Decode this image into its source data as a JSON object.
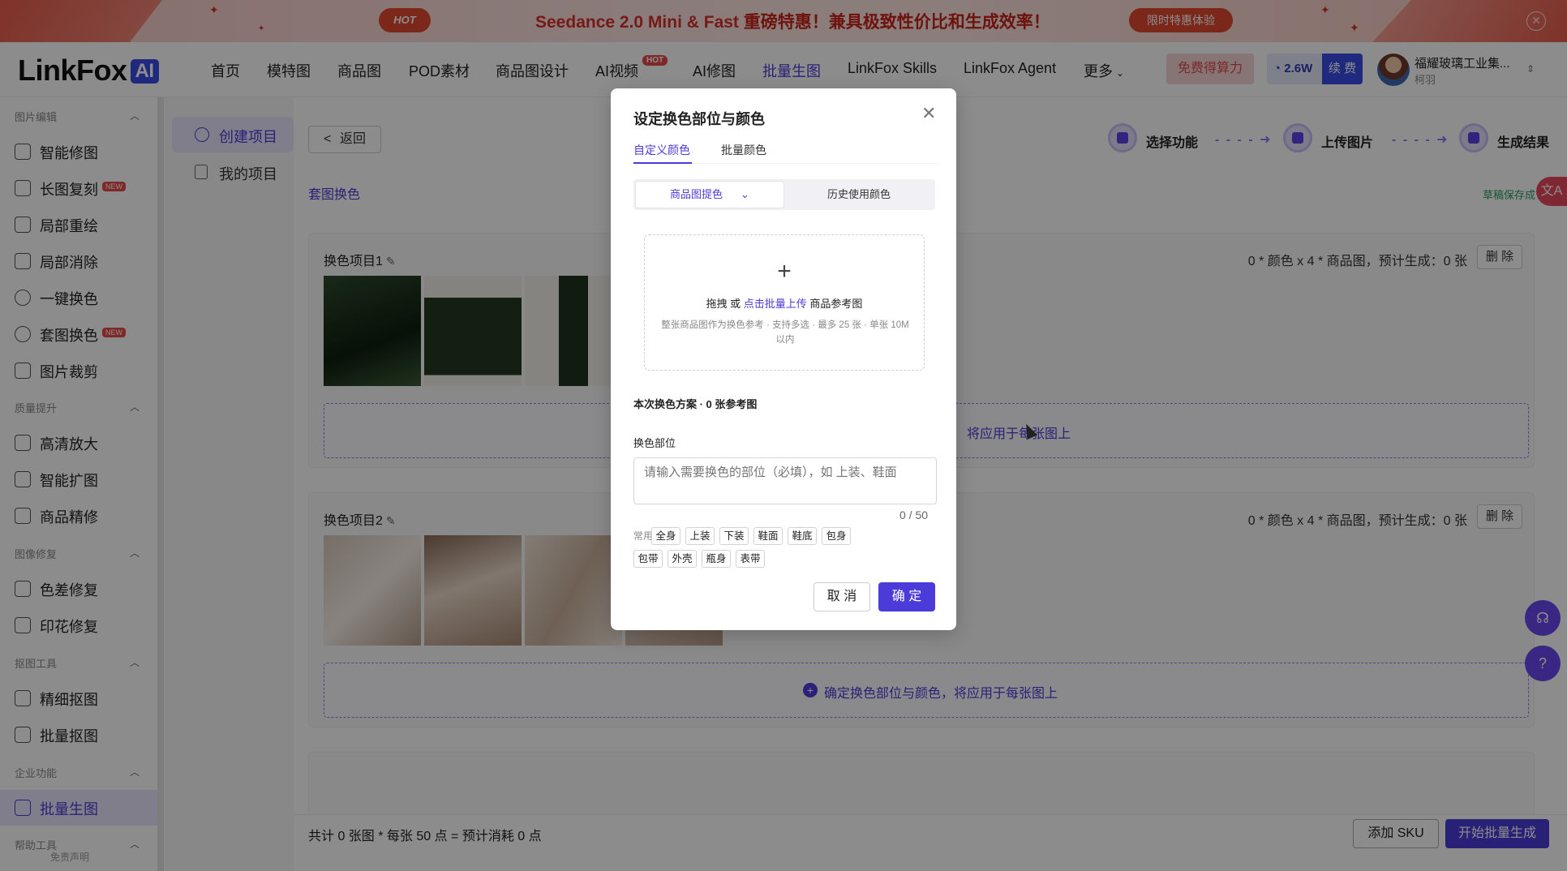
{
  "banner": {
    "hot": "HOT",
    "headline_a": "Seedance 2.0 Mini & Fast",
    "headline_b": " 重磅特惠！兼具极致性价比和生成效率！",
    "cta": "限时特惠体验"
  },
  "navbar": {
    "logo_text": "LinkFox",
    "logo_badge": "AI",
    "items": [
      "首页",
      "模特图",
      "商品图",
      "POD素材",
      "商品图设计",
      "AI视频",
      "AI修图",
      "批量生图",
      "LinkFox Skills",
      "LinkFox Agent",
      "更多"
    ],
    "hot_badge": "HOT",
    "active": "批量生图",
    "free_button": "免费得算力",
    "credit_value": "2.6W",
    "renew_button": "续 费",
    "user_name": "福耀玻璃工业集...",
    "user_sub": "柯羽"
  },
  "sidebar": {
    "groups": [
      {
        "title": "图片编辑",
        "items": [
          "智能修图",
          "长图复刻",
          "局部重绘",
          "局部消除",
          "一键换色",
          "套图换色",
          "图片裁剪"
        ]
      },
      {
        "title": "质量提升",
        "items": [
          "高清放大",
          "智能扩图",
          "商品精修"
        ]
      },
      {
        "title": "图像修复",
        "items": [
          "色差修复",
          "印花修复"
        ]
      },
      {
        "title": "抠图工具",
        "items": [
          "精细抠图",
          "批量抠图"
        ]
      },
      {
        "title": "企业功能",
        "items": [
          "批量生图"
        ]
      },
      {
        "title": "帮助工具",
        "items": []
      }
    ],
    "new_badge": "NEW",
    "footer": "免责声明"
  },
  "subnav": {
    "items": [
      "创建项目",
      "我的项目"
    ]
  },
  "main": {
    "back": "返回",
    "breadcrumb": "套图换色",
    "steps": [
      "选择功能",
      "上传图片",
      "生成结果"
    ],
    "step_arrow": "- - - - ➜",
    "draft": "草稿保存成",
    "translate_icon": "文A",
    "projects": [
      {
        "title": "换色项目1",
        "meta": "0 * 颜色 x 4 * 商品图，预计生成：0 张",
        "delete": "删 除",
        "apply": "确定换色部位与颜色，将应用于每张图上"
      },
      {
        "title": "换色项目2",
        "meta": "0 * 颜色 x 4 * 商品图，预计生成：0 张",
        "delete": "删 除",
        "apply": "确定换色部位与颜色，将应用于每张图上"
      }
    ],
    "apply_partial": "将应用于每张图上",
    "summary": "共计 0 张图 * 每张 50 点 = 预计消耗 0 点",
    "add_sku": "添加 SKU",
    "start": "开始批量生成"
  },
  "modal": {
    "title": "设定换色部位与颜色",
    "tabs": [
      "自定义颜色",
      "批量颜色"
    ],
    "seg_option1": "商品图提色",
    "seg_option2": "历史使用颜色",
    "upload_plus": "+",
    "upload_line1_a": "拖拽 或 ",
    "upload_line1_link": "点击批量上传",
    "upload_line1_b": " 商品参考图",
    "upload_line2": "整张商品图作为换色参考 · 支持多选 · 最多 25 张 · 单张 10M 以内",
    "plan": "本次换色方案 · 0 张参考图",
    "part_label": "换色部位",
    "part_placeholder": "请输入需要换色的部位（必填），如 上装、鞋面",
    "counter": "0 / 50",
    "common_label": "常用",
    "chips": [
      "全身",
      "上装",
      "下装",
      "鞋面",
      "鞋底",
      "包身",
      "包带",
      "外壳",
      "瓶身",
      "表带"
    ],
    "cancel": "取 消",
    "ok": "确 定"
  },
  "colors": {
    "accent": "#4b3bd9",
    "danger": "#e84a4a",
    "banner_red": "#e1482f"
  }
}
